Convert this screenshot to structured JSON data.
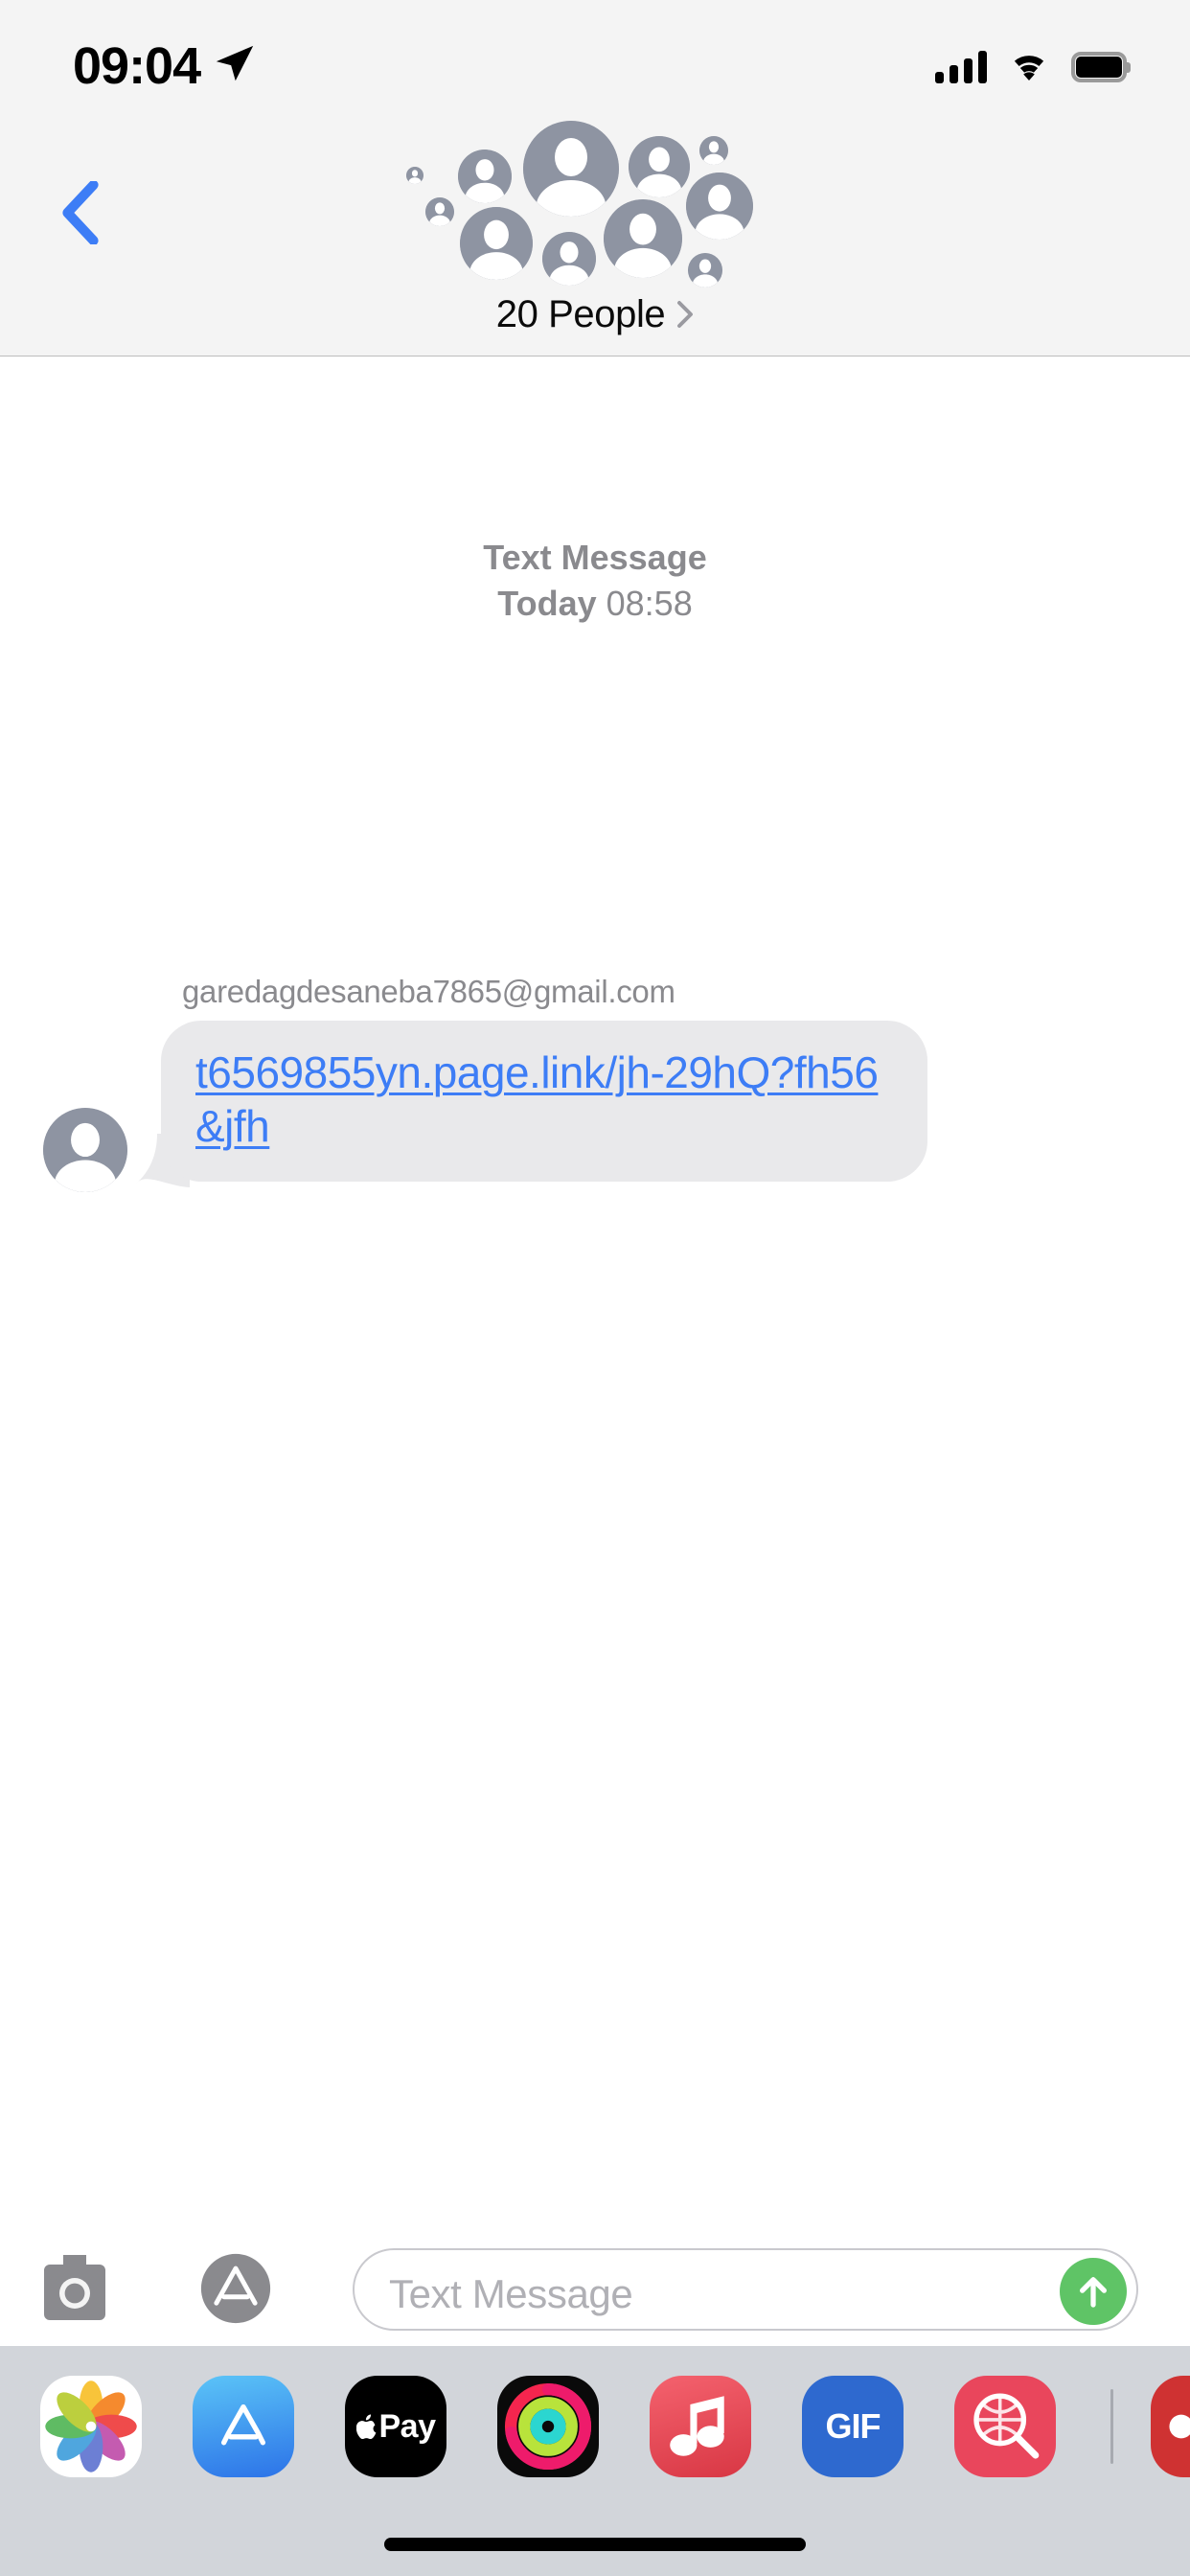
{
  "status_bar": {
    "time": "09:04",
    "location_icon": "location-arrow-icon",
    "signal_icon": "cellular-signal-icon",
    "signal_bars": 4,
    "wifi_icon": "wifi-icon",
    "battery_icon": "battery-full-icon",
    "background_color": "#F4F4F4"
  },
  "navbar": {
    "back_icon": "chevron-left-icon",
    "back_color": "#3D7DF6",
    "participants_label": "20 People",
    "disclosure_icon": "chevron-right-icon",
    "avatar_count": 11,
    "avatar_icon": "person-avatar-icon",
    "background_color": "#F4F4F4"
  },
  "thread": {
    "message_kind": "Text Message",
    "message_day": "Today",
    "message_time": "08:58",
    "messages": [
      {
        "sender": "garedagdesaneba7865@gmail.com",
        "avatar_icon": "person-avatar-icon",
        "text": "t6569855yn.page.link/jh-29hQ?fh56&jfh",
        "is_link": true,
        "bubble_color": "#E9E9EB",
        "link_color": "#3D7DF6"
      }
    ]
  },
  "input_bar": {
    "camera_icon": "camera-icon",
    "appstore_icon": "app-store-icon",
    "placeholder": "Text Message",
    "value": "",
    "send_icon": "arrow-up-icon",
    "send_color": "#5FC466"
  },
  "app_drawer": {
    "background_color": "#D2D5DA",
    "apps": [
      {
        "name": "photos",
        "label": "Photos",
        "icon": "photos-icon"
      },
      {
        "name": "app-store",
        "label": "App Store",
        "icon": "app-store-icon"
      },
      {
        "name": "apple-pay",
        "label": "Apple Pay",
        "icon": "apple-pay-icon",
        "text": "Pay"
      },
      {
        "name": "activity",
        "label": "Activity",
        "icon": "activity-rings-icon"
      },
      {
        "name": "music",
        "label": "Music",
        "icon": "music-note-icon"
      },
      {
        "name": "images",
        "label": "#images",
        "icon": "gif-icon",
        "text": "GIF"
      },
      {
        "name": "digital-touch",
        "label": "Digital Touch",
        "icon": "magnifier-globe-icon"
      },
      {
        "name": "more",
        "label": "More",
        "icon": "more-apps-icon"
      }
    ]
  },
  "home_indicator": {
    "label": "home-indicator"
  }
}
